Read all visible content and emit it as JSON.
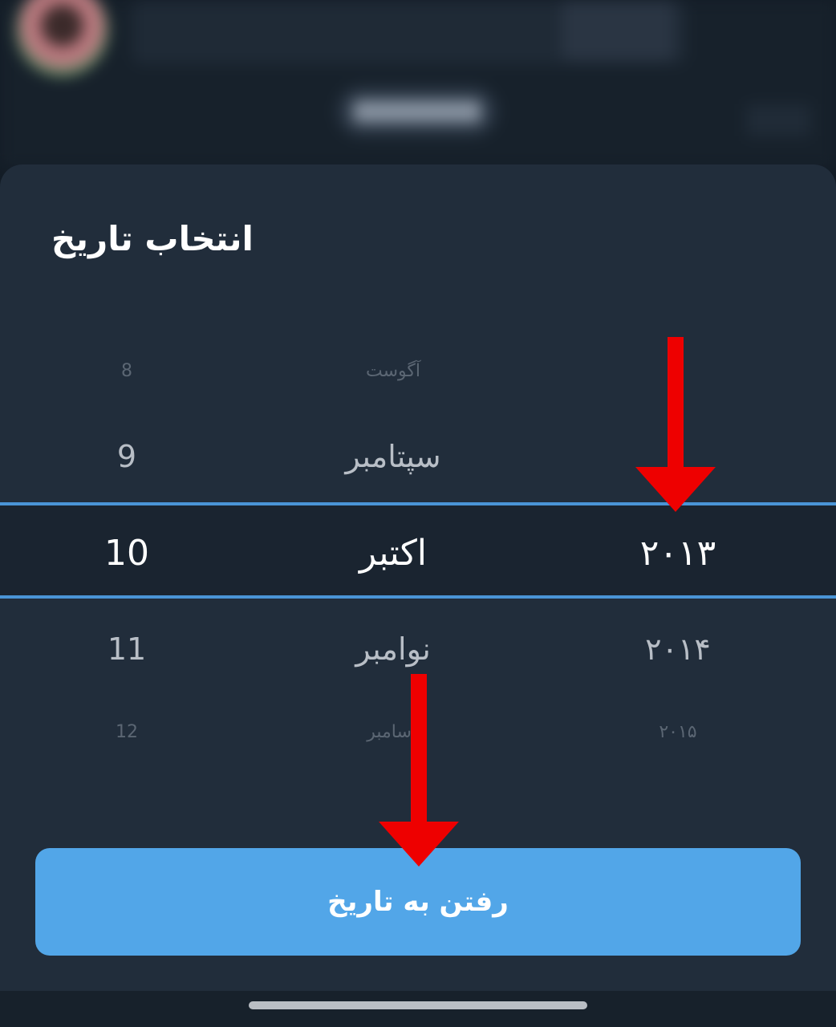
{
  "dialog": {
    "title": "انتخاب تاریخ",
    "button_label": "رفتن به تاریخ"
  },
  "picker": {
    "days": [
      "8",
      "9",
      "10",
      "11",
      "12"
    ],
    "months": [
      "آگوست",
      "سپتامبر",
      "اکتبر",
      "نوامبر",
      "دسامبر"
    ],
    "years": [
      "",
      "",
      "۲۰۱۳",
      "۲۰۱۴",
      "۲۰۱۵"
    ],
    "selected": {
      "day": "10",
      "month": "اکتبر",
      "year": "۲۰۱۳"
    }
  },
  "colors": {
    "sheet_bg": "#212d3b",
    "accent_line": "#4a94d6",
    "button_bg": "#52a6e8",
    "annotation_arrow": "#ee0000"
  }
}
